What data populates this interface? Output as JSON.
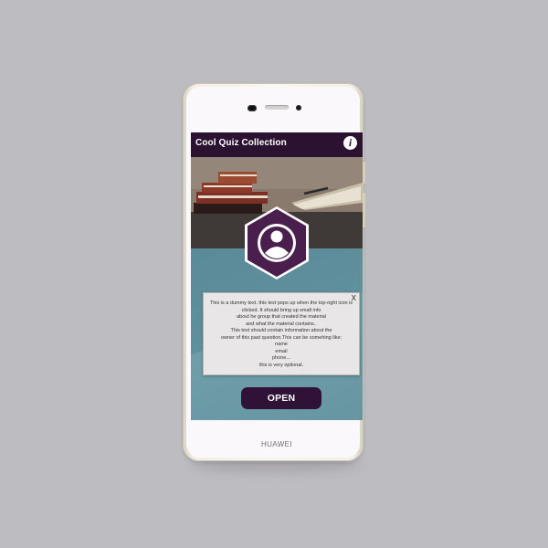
{
  "device": {
    "brand": "HUAWEI"
  },
  "app": {
    "title": "Cool Quiz Collection",
    "info_icon": "info-icon",
    "info_label": "i"
  },
  "popup": {
    "close_label": "X",
    "text": "This is a dummy text. this text pops up when the top-right icon is clicked. It should bring up small info\nabout he group that created the material\nand what the material contains..\nThis text should contain information about the\nowner of this past question.This  can be somehing like:\nname\nemail\nphone...\nthis is very optional."
  },
  "actions": {
    "open_label": "OPEN"
  },
  "colors": {
    "header_bg": "#2c1231",
    "button_bg": "#2f1236",
    "avatar_hex": "#4a1f4d",
    "screen_accent": "#5f8f9c"
  }
}
